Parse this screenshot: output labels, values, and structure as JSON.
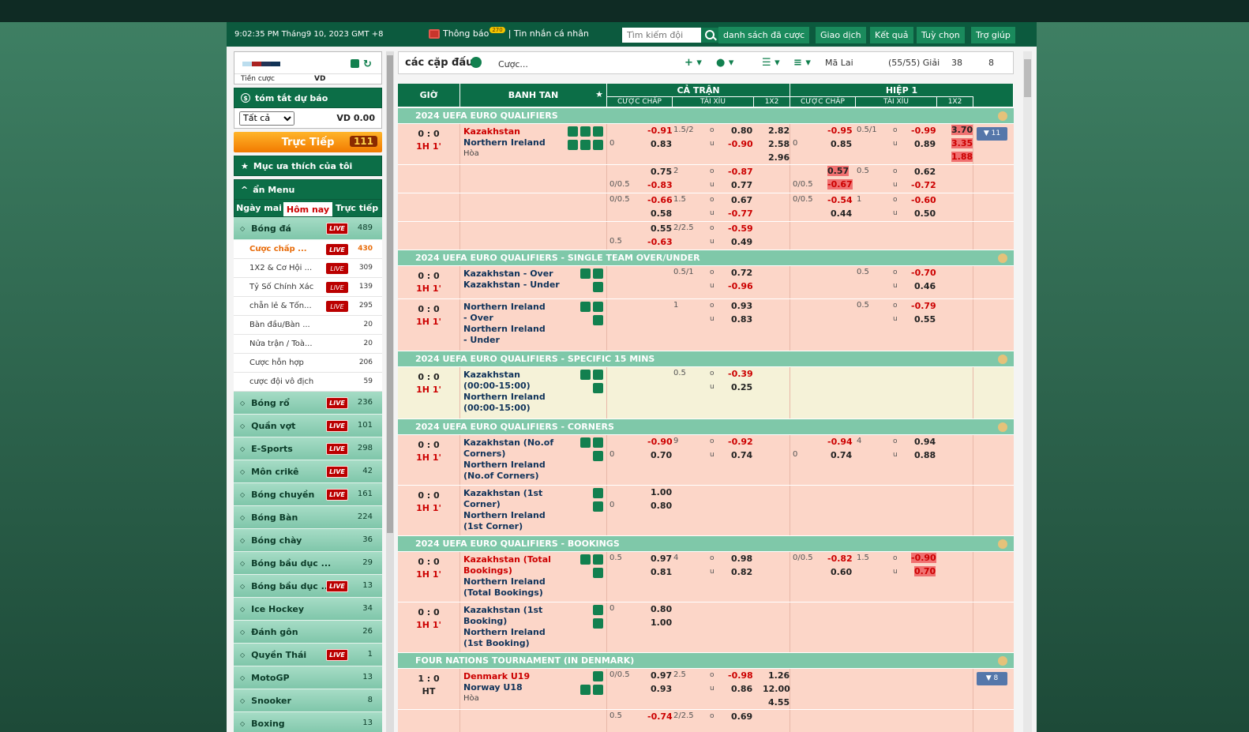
{
  "header": {
    "clock": "9:02:35 PM Tháng9 10, 2023 GMT +8",
    "notice": "Thông báo",
    "notice_count": "270",
    "messages": "| Tin nhắn cá nhân",
    "search_placeholder": "Tìm kiếm đội",
    "nav": [
      "danh sách đã cược",
      "Giao dịch",
      "Kết quả",
      "Tuỳ chọn",
      "Trợ giúp"
    ]
  },
  "balance": {
    "label": "Tiền cược",
    "currency": "VD"
  },
  "forecast": {
    "title": "tóm tắt dự báo",
    "filter": "Tất cả",
    "amount": "VD 0.00"
  },
  "live": {
    "label": "Trực Tiếp",
    "count": "111"
  },
  "favorites": "Mục ưa thích của tôi",
  "menu": {
    "title": "ẩn Menu",
    "tabs": [
      "Ngày mai",
      "Hôm nay",
      "Trực tiếp"
    ]
  },
  "sports": [
    {
      "name": "Bóng đá",
      "live": "LIVE",
      "count": "489"
    },
    {
      "name": "Bóng rổ",
      "live": "LIVE",
      "count": "236"
    },
    {
      "name": "Quần vợt",
      "live": "LIVE",
      "count": "101"
    },
    {
      "name": "E-Sports",
      "live": "LIVE",
      "count": "298"
    },
    {
      "name": "Môn crikê",
      "live": "LIVE",
      "count": "42"
    },
    {
      "name": "Bóng chuyền",
      "live": "LIVE",
      "count": "161"
    },
    {
      "name": "Bóng Bàn",
      "live": "",
      "count": "224"
    },
    {
      "name": "Bóng chày",
      "live": "",
      "count": "36"
    },
    {
      "name": "Bóng bầu dục ...",
      "live": "",
      "count": "29"
    },
    {
      "name": "Bóng bầu dục ...",
      "live": "LIVE",
      "count": "13"
    },
    {
      "name": "Ice Hockey",
      "live": "",
      "count": "34"
    },
    {
      "name": "Đánh gôn",
      "live": "",
      "count": "26"
    },
    {
      "name": "Quyền Thái",
      "live": "LIVE",
      "count": "1"
    },
    {
      "name": "MotoGP",
      "live": "",
      "count": "13"
    },
    {
      "name": "Snooker",
      "live": "",
      "count": "8"
    },
    {
      "name": "Boxing",
      "live": "",
      "count": "13"
    }
  ],
  "submenu": [
    {
      "name": "Cược chấp ...",
      "live": "LIVE",
      "count": "430"
    },
    {
      "name": "1X2 & Cơ Hội ...",
      "live": "LIVE",
      "count": "309"
    },
    {
      "name": "Tỷ Số Chính Xác",
      "live": "LIVE",
      "count": "139"
    },
    {
      "name": "chẵn lẻ & Tốn...",
      "live": "LIVE",
      "count": "295"
    },
    {
      "name": "Bàn đầu/Bàn ...",
      "live": "",
      "count": "20"
    },
    {
      "name": "Nửa trận / Toà...",
      "live": "",
      "count": "20"
    },
    {
      "name": "Cược hỗn hợp",
      "live": "",
      "count": "206"
    },
    {
      "name": "cược đội vô địch",
      "live": "",
      "count": "59"
    }
  ],
  "toolbar": {
    "title": "các cặp đấu",
    "bet": "Cược...",
    "odds_type": "Mã Lai",
    "leagues": "(55/55) Giải",
    "refresh": "38",
    "count": "8"
  },
  "table": {
    "h_time": "GIỜ",
    "h_team": "BANH TAN",
    "h_full": "CẢ TRẬN",
    "h_half": "HIỆP 1",
    "sub": [
      "CƯỢC CHẤP",
      "TÀI XỈU",
      "1X2",
      "CƯỢC CHẤP",
      "TÀI XỈU",
      "1X2"
    ]
  },
  "leagues": {
    "l1": "2024 UEFA EURO QUALIFIERS",
    "l2": "2024 UEFA EURO QUALIFIERS - SINGLE TEAM OVER/UNDER",
    "l3": "2024 UEFA EURO QUALIFIERS - SPECIFIC 15 MINS",
    "l4": "2024 UEFA EURO QUALIFIERS - CORNERS",
    "l5": "2024 UEFA EURO QUALIFIERS - BOOKINGS",
    "l6": "FOUR NATIONS TOURNAMENT (IN DENMARK)"
  },
  "m": {
    "score00": "0 : 0",
    "score10": "1 : 0",
    "t1h": "1H 1'",
    "tht": "HT",
    "hoa": "Hòa",
    "o": "o",
    "u": "u",
    "kaz": "Kazakhstan",
    "nir": "Northern Ireland",
    "kaz_over": "Kazakhstan - Over",
    "kaz_under": "Kazakhstan - Under",
    "nir_over": "Northern Ireland - Over",
    "nir_under": "Northern Ireland - Under",
    "kaz15": "Kazakhstan (00:00-15:00)",
    "nir15": "Northern Ireland (00:00-15:00)",
    "kazc": "Kazakhstan (No.of Corners)",
    "nirc": "Northern Ireland (No.of Corners)",
    "kaz1c": "Kazakhstan (1st Corner)",
    "nir1c": "Northern Ireland (1st Corner)",
    "kazb": "Kazakhstan (Total Bookings)",
    "nirb": "Northern Ireland (Total Bookings)",
    "kaz1b": "Kazakhstan (1st Booking)",
    "nir1b": "Northern Ireland (1st Booking)",
    "den": "Denmark U19",
    "nor": "Norway U18",
    "more11": "▼ 11",
    "more8": "▼ 8"
  }
}
